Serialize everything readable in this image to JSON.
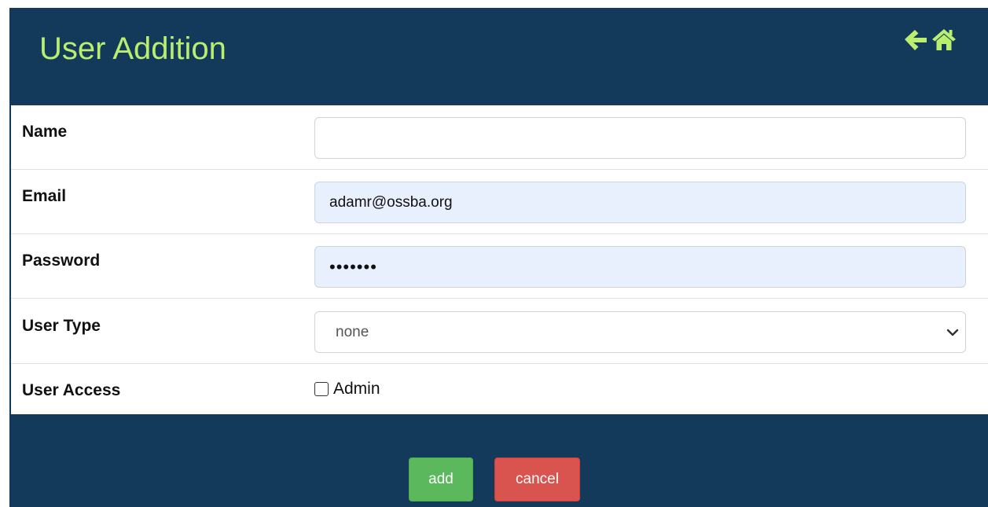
{
  "header": {
    "title": "User Addition",
    "back_icon": "arrow-left-icon",
    "home_icon": "home-icon",
    "icon_color": "#b9ee6f"
  },
  "form": {
    "name": {
      "label": "Name",
      "value": ""
    },
    "email": {
      "label": "Email",
      "value": "adamr@ossba.org"
    },
    "password": {
      "label": "Password",
      "value": "•••••••"
    },
    "user_type": {
      "label": "User Type",
      "selected": "none"
    },
    "user_access": {
      "label": "User Access",
      "option_label": "Admin",
      "checked": false
    }
  },
  "actions": {
    "add_label": "add",
    "cancel_label": "cancel"
  },
  "colors": {
    "background": "#133a5a",
    "accent": "#b9ee6f",
    "add_button": "#5cb85c",
    "cancel_button": "#d9534f",
    "autofill": "#e8f0fe"
  }
}
